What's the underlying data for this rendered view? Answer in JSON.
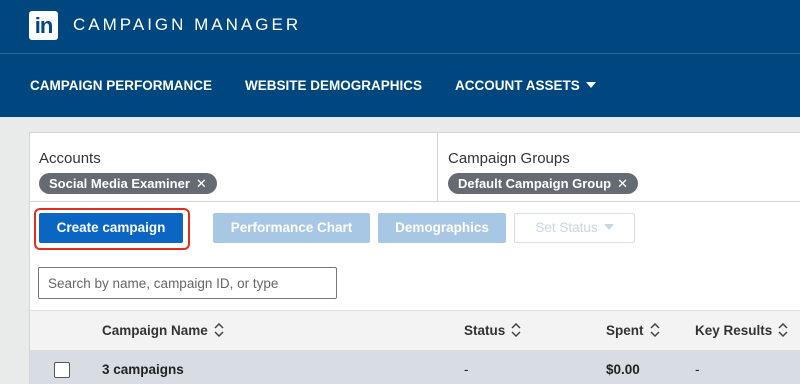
{
  "header": {
    "logo_text": "in",
    "app_title": "CAMPAIGN MANAGER"
  },
  "nav": {
    "items": [
      "CAMPAIGN PERFORMANCE",
      "WEBSITE DEMOGRAPHICS",
      "ACCOUNT ASSETS"
    ]
  },
  "filters": {
    "accounts": {
      "label": "Accounts",
      "chip": "Social Media Examiner"
    },
    "campaign_groups": {
      "label": "Campaign Groups",
      "chip": "Default Campaign Group"
    },
    "remove_glyph": "✕"
  },
  "toolbar": {
    "create_label": "Create campaign",
    "performance_chart_label": "Performance Chart",
    "demographics_label": "Demographics",
    "set_status_label": "Set Status"
  },
  "search": {
    "placeholder": "Search by name, campaign ID, or type",
    "value": ""
  },
  "table": {
    "columns": [
      "Campaign Name",
      "Status",
      "Spent",
      "Key Results"
    ],
    "rows": [
      {
        "name": "3 campaigns",
        "status": "-",
        "spent": "$0.00",
        "key_results": "-"
      }
    ]
  },
  "colors": {
    "header_bg": "#00477f",
    "primary": "#0a66c2",
    "highlight": "#e32c1e",
    "chip_bg": "#666b73"
  }
}
